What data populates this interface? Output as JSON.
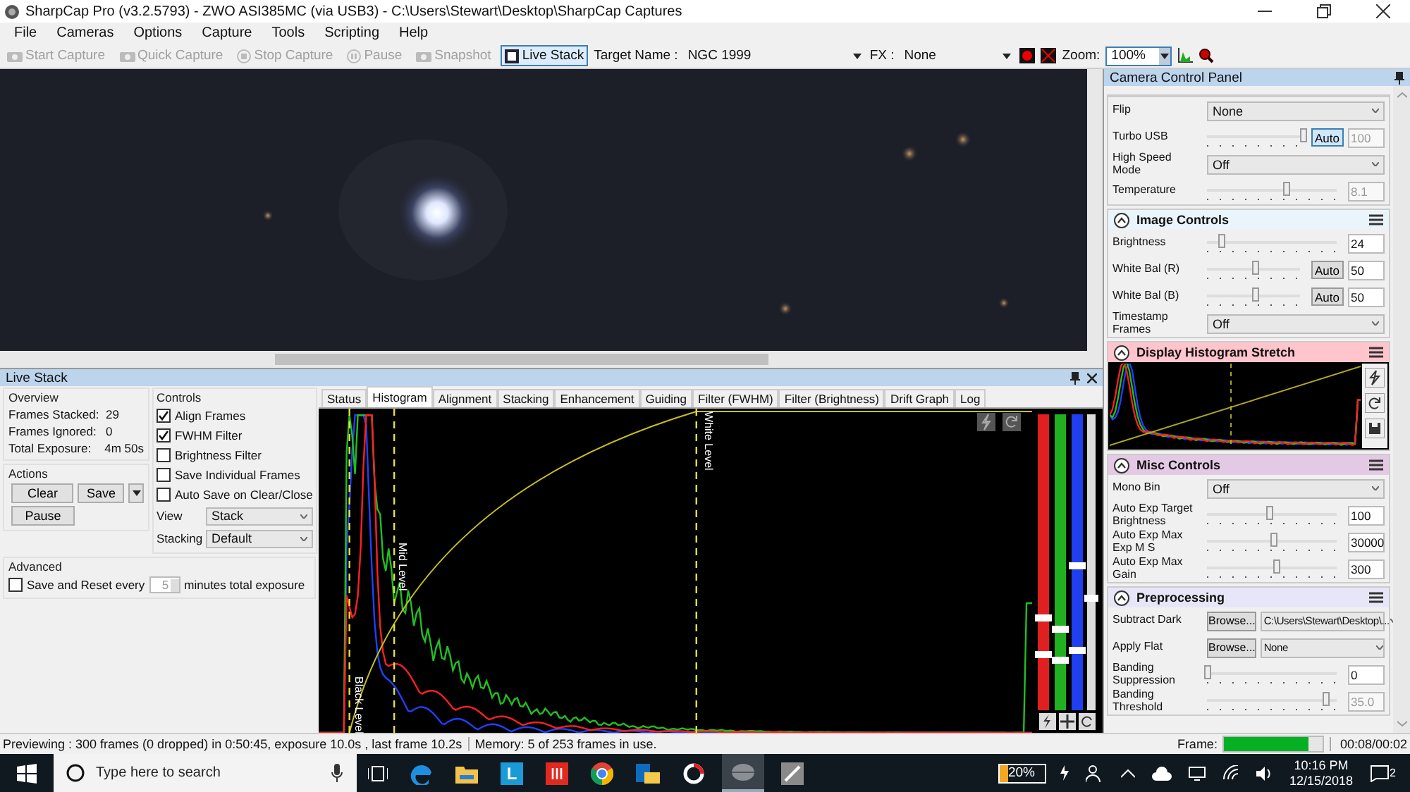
{
  "title_bar": {
    "title": "SharpCap Pro (v3.2.5793) - ZWO ASI385MC (via USB3) - C:\\Users\\Stewart\\Desktop\\SharpCap Captures"
  },
  "menu": [
    "File",
    "Cameras",
    "Options",
    "Capture",
    "Tools",
    "Scripting",
    "Help"
  ],
  "toolbar": {
    "buttons": [
      {
        "label": "Start Capture",
        "disabled": true,
        "selected": false
      },
      {
        "label": "Quick Capture",
        "disabled": true,
        "selected": false
      },
      {
        "label": "Stop Capture",
        "disabled": true,
        "selected": false
      },
      {
        "label": "Pause",
        "disabled": true,
        "selected": false
      },
      {
        "label": "Snapshot",
        "disabled": true,
        "selected": false
      },
      {
        "label": "Live Stack",
        "disabled": false,
        "selected": true
      }
    ],
    "target_label": "Target Name :",
    "target_value": "NGC 1999",
    "fx_label": "FX :",
    "fx_value": "None",
    "zoom_label": "Zoom:",
    "zoom_value": "100%"
  },
  "live_stack": {
    "title": "Live Stack",
    "overview": {
      "heading": "Overview",
      "stats": [
        {
          "label": "Frames Stacked:",
          "value": "29"
        },
        {
          "label": "Frames Ignored:",
          "value": "0"
        },
        {
          "label": "Total Exposure:",
          "value": "4m 50s"
        }
      ]
    },
    "actions": {
      "heading": "Actions",
      "clear": "Clear",
      "save": "Save",
      "pause": "Pause"
    },
    "controls": {
      "heading": "Controls",
      "checkboxes": [
        {
          "label": "Align Frames",
          "checked": true
        },
        {
          "label": "FWHM Filter",
          "checked": true
        },
        {
          "label": "Brightness Filter",
          "checked": false
        },
        {
          "label": "Save Individual Frames",
          "checked": false
        },
        {
          "label": "Auto Save on Clear/Close",
          "checked": false
        }
      ],
      "selects": [
        {
          "label": "View",
          "value": "Stack"
        },
        {
          "label": "Stacking",
          "value": "Default"
        }
      ]
    },
    "advanced": {
      "heading": "Advanced",
      "checkbox": {
        "label": "Save and Reset every",
        "checked": false
      },
      "spin_value": "5",
      "suffix": "minutes total exposure"
    },
    "tabs": [
      {
        "label": "Status",
        "selected": false
      },
      {
        "label": "Histogram",
        "selected": true
      },
      {
        "label": "Alignment",
        "selected": false
      },
      {
        "label": "Stacking",
        "selected": false
      },
      {
        "label": "Enhancement",
        "selected": false
      },
      {
        "label": "Guiding",
        "selected": false
      },
      {
        "label": "Filter (FWHM)",
        "selected": false
      },
      {
        "label": "Filter (Brightness)",
        "selected": false
      },
      {
        "label": "Drift Graph",
        "selected": false
      },
      {
        "label": "Log",
        "selected": false
      }
    ],
    "histogram": {
      "mid_label": "Mid Level",
      "black_label": "Black Level",
      "white_label": "White Level"
    }
  },
  "camera_panel": {
    "title": "Camera Control Panel",
    "sections": [
      {
        "kind": "rows",
        "rows": [
          {
            "kind": "select",
            "label": "Flip",
            "value": "None"
          },
          {
            "kind": "slider",
            "label": "Turbo USB",
            "level": 0.97,
            "auto": {
              "label": "Auto",
              "selected": true
            },
            "value": "100",
            "disabled": true
          },
          {
            "kind": "select",
            "label": "High Speed Mode",
            "value": "Off"
          },
          {
            "kind": "slider",
            "label": "Temperature",
            "level": 0.58,
            "value": "8.1",
            "disabled": true
          }
        ]
      },
      {
        "kind": "rows",
        "title": "Image Controls",
        "color": "#eaf4fb",
        "rows": [
          {
            "kind": "slider",
            "label": "Brightness",
            "level": 0.1,
            "value": "24",
            "disabled": false
          },
          {
            "kind": "slider",
            "label": "White Bal (R)",
            "level": 0.48,
            "auto": {
              "label": "Auto",
              "selected": false
            },
            "value": "50",
            "disabled": false
          },
          {
            "kind": "slider",
            "label": "White Bal (B)",
            "level": 0.48,
            "auto": {
              "label": "Auto",
              "selected": false
            },
            "value": "50",
            "disabled": false
          },
          {
            "kind": "select",
            "label": "Timestamp Frames",
            "value": "Off"
          }
        ]
      },
      {
        "kind": "histogram",
        "title": "Display Histogram Stretch",
        "color": "#ffc4cc"
      },
      {
        "kind": "rows",
        "title": "Misc Controls",
        "color": "#e3c9e3",
        "rows": [
          {
            "kind": "select",
            "label": "Mono Bin",
            "value": "Off"
          },
          {
            "kind": "slider",
            "label": "Auto Exp Target Brightness",
            "level": 0.45,
            "value": "100",
            "disabled": false
          },
          {
            "kind": "slider",
            "label": "Auto Exp Max Exp M S",
            "level": 0.48,
            "value": "30000",
            "disabled": false
          },
          {
            "kind": "slider",
            "label": "Auto Exp Max Gain",
            "level": 0.5,
            "value": "300",
            "disabled": false
          }
        ]
      },
      {
        "kind": "rows",
        "title": "Preprocessing",
        "color": "#e6e6f8",
        "rows": [
          {
            "kind": "browse",
            "label": "Subtract Dark",
            "button": "Browse...",
            "value": "C:\\Users\\Stewart\\Desktop\\..."
          },
          {
            "kind": "browse",
            "label": "Apply Flat",
            "button": "Browse...",
            "value": "None"
          },
          {
            "kind": "slider",
            "label": "Banding Suppression",
            "level": 0.0,
            "value": "0",
            "disabled": false
          },
          {
            "kind": "slider",
            "label": "Banding Threshold",
            "level": 0.87,
            "value": "35.0",
            "disabled": true
          }
        ]
      }
    ]
  },
  "status_bar": {
    "message": "Previewing : 300 frames (0 dropped) in 0:50:45, exposure 10.0s , last frame 10.2s",
    "memory": "Memory: 5 of 253 frames in use.",
    "frame_progress": {
      "label": "Frame:",
      "level": 0.85
    },
    "elapsed": "00:08/00:02"
  },
  "taskbar": {
    "search_placeholder": "Type here to search",
    "tile_letter": "L",
    "battery": "20%",
    "time": "10:16 PM",
    "date": "12/15/2018",
    "notifications": "2"
  }
}
